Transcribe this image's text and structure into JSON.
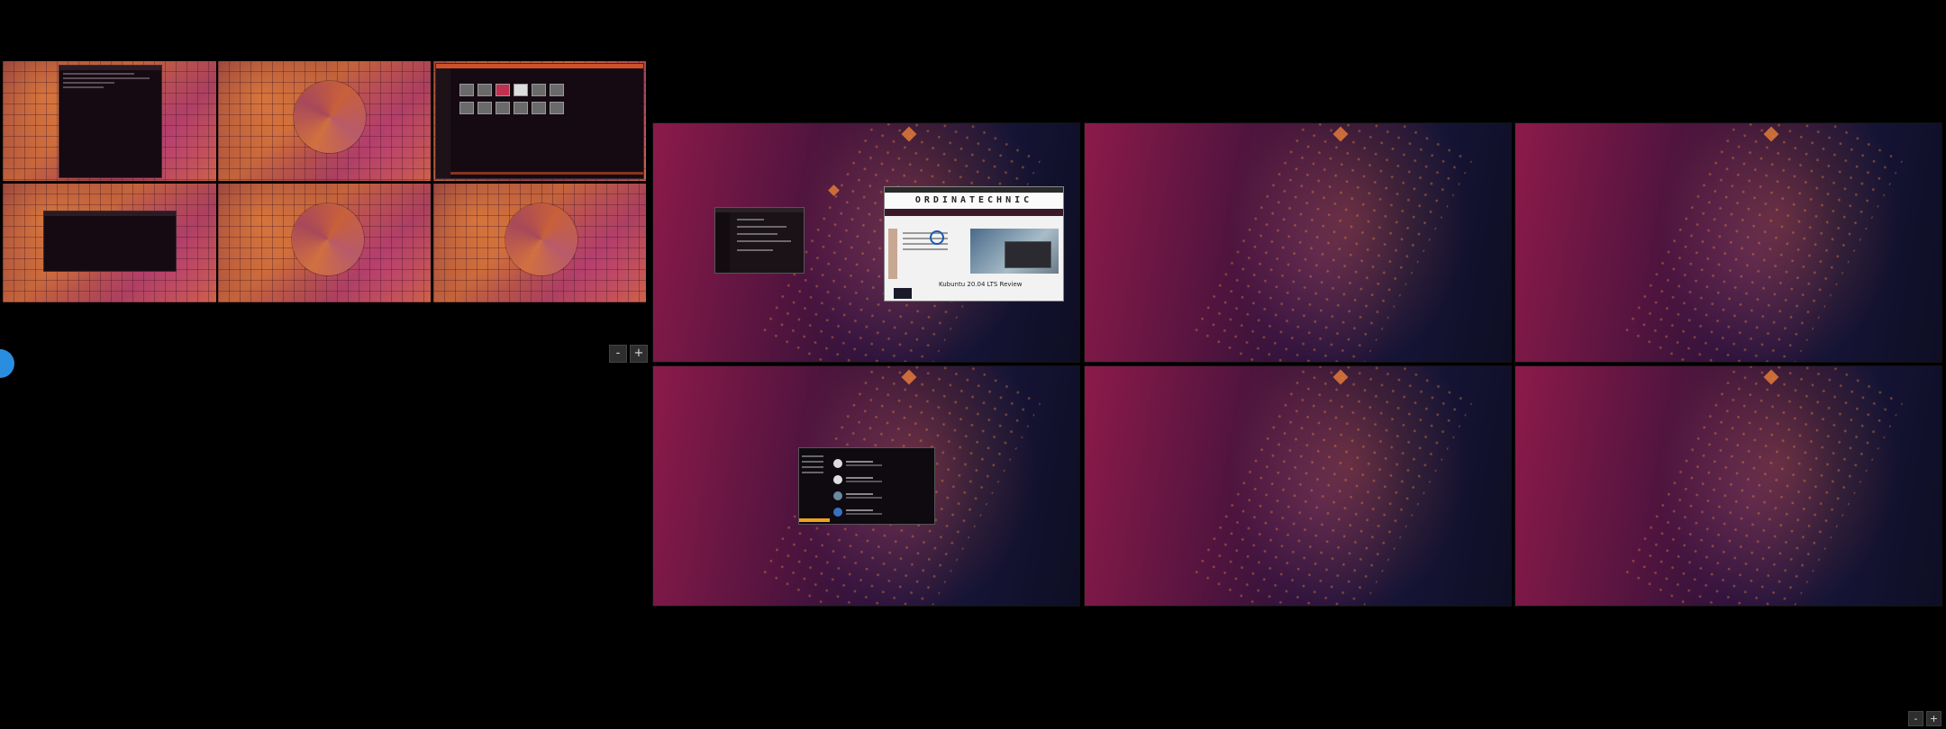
{
  "overview": {
    "left_monitor": {
      "workspace_count": 6,
      "zoom_out_label": "-",
      "zoom_in_label": "+"
    },
    "right_monitor": {
      "workspace_count": 6
    },
    "bottom_controls": {
      "zoom_out_label": "-",
      "zoom_in_label": "+"
    }
  },
  "windows": {
    "browser": {
      "site_brand": "ORDINATECHNIC",
      "article_headline": "Kubuntu 20.04 LTS Review"
    }
  },
  "colors": {
    "background": "#000000",
    "accent_blue": "#2a8ee0",
    "store_highlight": "#f0a020"
  }
}
